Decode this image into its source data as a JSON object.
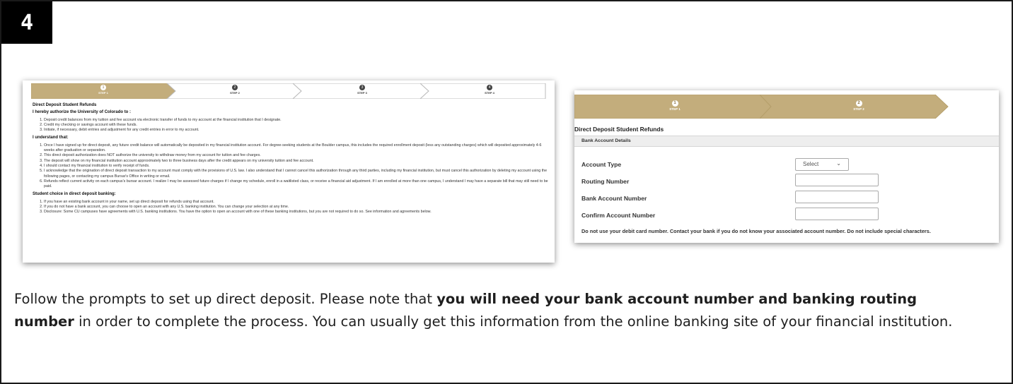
{
  "badge": "4",
  "left_screenshot": {
    "steps": [
      {
        "number": "1",
        "label": "STEP 1"
      },
      {
        "number": "2",
        "label": "STEP 2"
      },
      {
        "number": "3",
        "label": "STEP 3"
      },
      {
        "number": "4",
        "label": "STEP 4"
      }
    ],
    "title": "Direct Deposit Student Refunds",
    "authorize_heading": "I hereby authorize the University of Colorado to :",
    "authorize_items": [
      "Deposit credit balances from my tuition and fee account via electronic transfer of funds to my account at the financial institution that I designate.",
      "Credit my checking or savings account with these funds.",
      "Initiate, if necessary, debit entries and adjustment for any credit entries in error to my account."
    ],
    "understand_heading": "I understand that:",
    "understand_items": [
      "Once I have signed up for direct deposit, any future credit balance will automatically be deposited in my financial institution account. For degree-seeking students at the Boulder campus, this includes the required enrollment deposit (less any outstanding charges) which will deposited approximately 4-6 weeks after graduation or separation.",
      "This direct deposit authorization does NOT authorize the university to withdraw money from my account for tuition and fee charges.",
      "The deposit will show on my financial institution account approximately two to three business days after the credit appears on my university tuition and fee account.",
      "I should contact my financial institution to verify receipt of funds.",
      "I acknowledge that the origination of direct deposit transaction to my account must comply with the provisions of U.S. law. I also understand that I cannot cancel this authorization through any third parties, including my financial institution, but must cancel this authorization by deleting my account using the following pages, or contacting my campus Bursar's Office in writing or email.",
      "Refunds reflect current activity on each campus's bursar account. I realize I may be assessed future charges if I change my schedule, enroll in a waitlisted class, or receive a financial aid adjustment. If I am enrolled at more than one campus, I understand I may have a separate bill that may still need to be paid."
    ],
    "choice_heading": "Student choice in direct deposit banking:",
    "choice_items": [
      "If you have an existing bank account in your name, set up direct deposit for refunds using that account.",
      "If you do not have a bank account, you can choose to open an account with any U.S. banking institution. You can change your selection at any time.",
      "Disclosure: Some CU campuses have agreements with U.S. banking institutions. You have the option to open an account with one of these banking institutions, but you are not required to do so. See information and agreements below."
    ]
  },
  "right_screenshot": {
    "steps": [
      {
        "number": "1",
        "label": "STEP 1"
      },
      {
        "number": "2",
        "label": "STEP 2"
      }
    ],
    "title": "Direct Deposit Student Refunds",
    "section": "Bank Account Details",
    "account_type_label": "Account Type",
    "account_type_value": "Select",
    "routing_label": "Routing Number",
    "bank_account_label": "Bank Account Number",
    "confirm_label": "Confirm Account Number",
    "note": "Do not use your debit card number. Contact your bank if you do not know your associated account number. Do not include special characters."
  },
  "caption": {
    "part1": "Follow the prompts to set up direct deposit. Please note that ",
    "bold": "you will need your bank account number and banking routing number",
    "part2": " in order to complete the process. You can usually get this information from the online banking site of your financial institution."
  },
  "colors": {
    "accent": "#c3ad7c",
    "badge": "#000000"
  }
}
